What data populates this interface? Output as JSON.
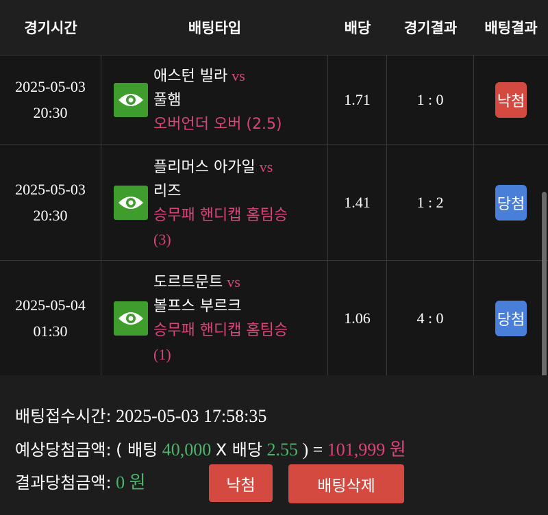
{
  "header": {
    "time": "경기시간",
    "type": "배팅타입",
    "odds": "배당",
    "score": "경기결과",
    "result": "배팅결과"
  },
  "rows": [
    {
      "date": "2025-05-03",
      "time": "20:30",
      "home": "애스턴 빌라",
      "vs": "vs",
      "away": "풀햄",
      "pick_line1": "오버언더 오버 (2.5)",
      "pick_line2": "",
      "odds": "1.71",
      "score": "1 : 0",
      "result": "낙첨"
    },
    {
      "date": "2025-05-03",
      "time": "20:30",
      "home": "플리머스 아가일",
      "vs": "vs",
      "away": "리즈",
      "pick_line1": "승무패 핸디캡 홈팀승",
      "pick_line2": "(3)",
      "odds": "1.41",
      "score": "1 : 2",
      "result": "당첨"
    },
    {
      "date": "2025-05-04",
      "time": "01:30",
      "home": "도르트문트",
      "vs": "vs",
      "away": "볼프스 부르크",
      "pick_line1": "승무패 핸디캡 홈팀승",
      "pick_line2": "(1)",
      "odds": "1.06",
      "score": "4 : 0",
      "result": "당첨"
    }
  ],
  "footer": {
    "bet_time_label": "배팅접수시간:",
    "bet_time_value": "2025-05-03 17:58:35",
    "expected_label": "예상당첨금액:",
    "expected_open": "( 배팅",
    "stake": "40,000",
    "x": "X 배당",
    "total_odds": "2.55",
    "eq": ") =",
    "payout": "101,999 원",
    "result_label": "결과당첨금액:",
    "result_value": "0 원",
    "lose_button": "낙첨",
    "delete_button": "배팅삭제"
  },
  "colors": {
    "lose": "#d44a40",
    "win": "#4a7fd9",
    "eye": "#3f9d2e",
    "pink": "#d9457b",
    "green": "#4fb36a"
  },
  "icons": {
    "detail": "eye-icon"
  }
}
